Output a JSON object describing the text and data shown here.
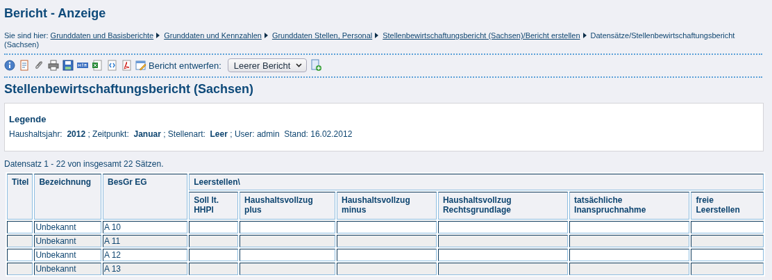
{
  "page_title": "Bericht - Anzeige",
  "breadcrumb": {
    "label": "Sie sind hier:",
    "items": [
      {
        "text": "Grunddaten und Basisberichte",
        "link": true
      },
      {
        "text": "Grunddaten und Kennzahlen",
        "link": true
      },
      {
        "text": "Grunddaten Stellen, Personal",
        "link": true
      },
      {
        "text": "Stellenbewirtschaftungsbericht (Sachsen)/Bericht erstellen",
        "link": true
      },
      {
        "text": "Datensätze/Stellenbewirtschaftungsbericht",
        "link": false,
        "continued": "(Sachsen)"
      }
    ]
  },
  "toolbar": {
    "design_label": "Bericht entwerfen:",
    "design_select": "Leerer Bericht"
  },
  "report_title": "Stellenbewirtschaftungsbericht (Sachsen)",
  "legend": {
    "title": "Legende",
    "text": "Haushaltsjahr:  **2012** ; Zeitpunkt:  **Januar** ; Stellenart:  **Leer** ; User: admin  Stand: 16.02.2012"
  },
  "record_count": "Datensatz 1 - 22 von insgesamt 22 Sätzen.",
  "table": {
    "group_header": "Leerstellen\\",
    "columns": [
      "Titel",
      "Bezeichnung",
      "BesGr EG",
      "Soll lt. HHPl",
      "Haushaltsvollzug plus",
      "Haushaltsvollzug minus",
      "Haushaltsvollzug Rechtsgrundlage",
      "tatsächliche Inanspruchnahme",
      "freie Leerstellen"
    ],
    "rows": [
      [
        "",
        "Unbekannt",
        "A 10",
        "",
        "",
        "",
        "",
        "",
        ""
      ],
      [
        "",
        "Unbekannt",
        "A 11",
        "",
        "",
        "",
        "",
        "",
        ""
      ],
      [
        "",
        "Unbekannt",
        "A 12",
        "",
        "",
        "",
        "",
        "",
        ""
      ],
      [
        "",
        "Unbekannt",
        "A 13",
        "",
        "",
        "",
        "",
        "",
        ""
      ]
    ]
  }
}
